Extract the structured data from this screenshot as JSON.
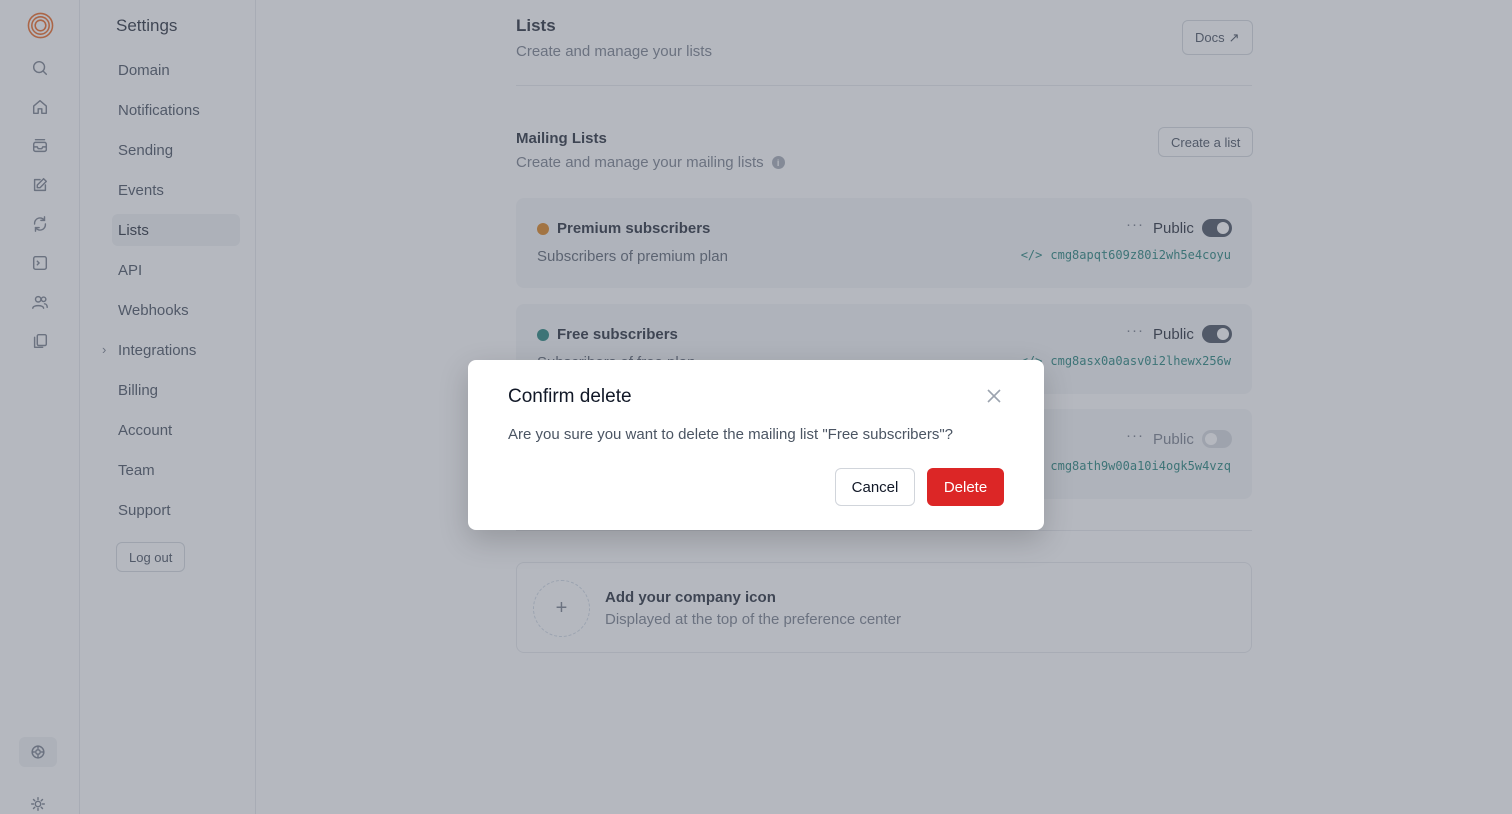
{
  "rail": {
    "icons": [
      "logo-icon",
      "search-icon",
      "home-icon",
      "inbox-icon",
      "edit-icon",
      "refresh-icon",
      "terminal-icon",
      "users-icon",
      "copy-icon",
      "settings-icon",
      "sun-icon"
    ]
  },
  "nav": {
    "title": "Settings",
    "items": [
      {
        "label": "Domain"
      },
      {
        "label": "Notifications"
      },
      {
        "label": "Sending"
      },
      {
        "label": "Events"
      },
      {
        "label": "Lists",
        "active": true
      },
      {
        "label": "API"
      },
      {
        "label": "Webhooks"
      },
      {
        "label": "Integrations",
        "expandable": true
      },
      {
        "label": "Billing"
      },
      {
        "label": "Account"
      },
      {
        "label": "Team"
      },
      {
        "label": "Support"
      }
    ],
    "logout_label": "Log out"
  },
  "page": {
    "title": "Lists",
    "subtitle": "Create and manage your lists",
    "docs_label": "Docs",
    "docs_arrow": "↗"
  },
  "mailing": {
    "title": "Mailing Lists",
    "subtitle": "Create and manage your mailing lists",
    "create_label": "Create a list",
    "lists": [
      {
        "name": "Premium subscribers",
        "description": "Subscribers of premium plan",
        "color": "#d97706",
        "public_label": "Public",
        "public": true,
        "id": "cmg8apqt609z80i2wh5e4coyu"
      },
      {
        "name": "Free subscribers",
        "description": "Subscribers of free plan",
        "color": "#0f766e",
        "public_label": "Public",
        "public": true,
        "id": "cmg8asx0a0asv0i2lhewx256w"
      },
      {
        "name": "",
        "description": "",
        "color": "#9ca3af",
        "public_label": "Public",
        "public": false,
        "id": "cmg8ath9w00a10i4ogk5w4vzq"
      }
    ]
  },
  "company": {
    "title": "Add your company icon",
    "subtitle": "Displayed at the top of the preference center",
    "plus": "+"
  },
  "modal": {
    "title": "Confirm delete",
    "body": "Are you sure you want to delete the mailing list \"Free subscribers\"?",
    "cancel_label": "Cancel",
    "delete_label": "Delete",
    "delete_color": "#dc2626"
  }
}
